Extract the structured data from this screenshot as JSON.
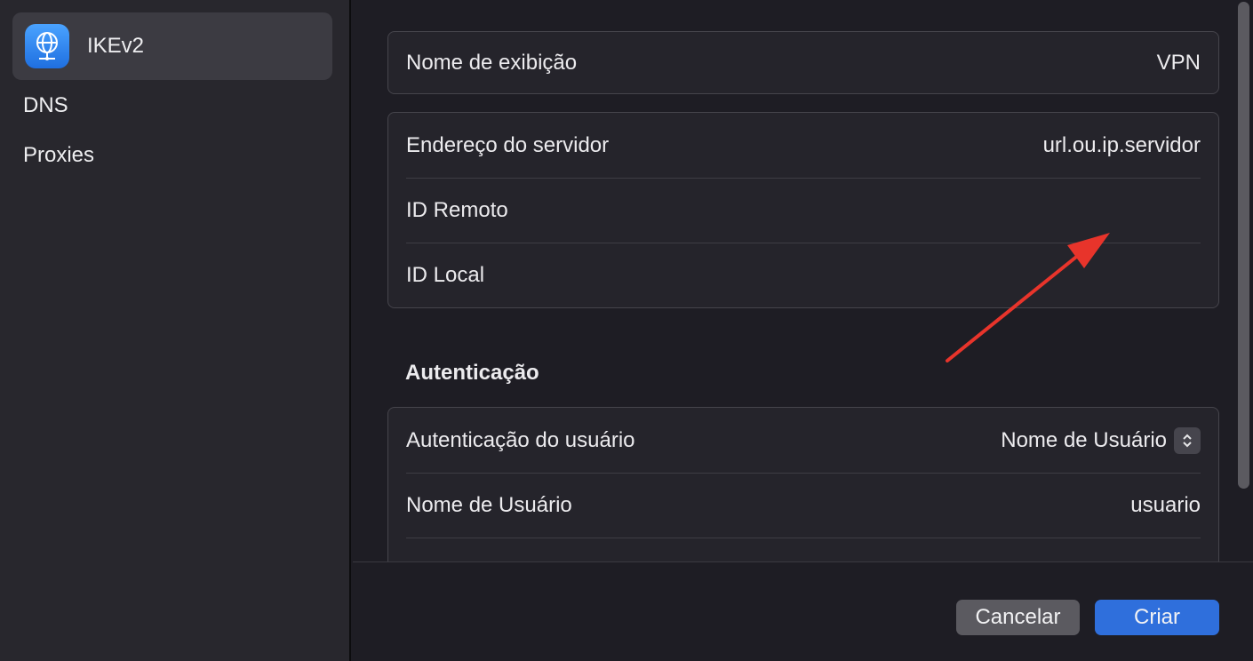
{
  "sidebar": {
    "items": [
      {
        "label": "IKEv2",
        "icon": "globe-network-icon",
        "selected": true
      },
      {
        "label": "DNS"
      },
      {
        "label": "Proxies"
      }
    ]
  },
  "general": {
    "display_name_label": "Nome de exibição",
    "display_name_value": "VPN"
  },
  "server": {
    "address_label": "Endereço do servidor",
    "address_value": "url.ou.ip.servidor",
    "remote_id_label": "ID Remoto",
    "remote_id_value": "",
    "local_id_label": "ID Local",
    "local_id_value": ""
  },
  "auth": {
    "section_title": "Autenticação",
    "user_auth_label": "Autenticação do usuário",
    "user_auth_value": "Nome de Usuário",
    "username_label": "Nome de Usuário",
    "username_value": "usuario"
  },
  "footer": {
    "cancel_label": "Cancelar",
    "create_label": "Criar"
  },
  "colors": {
    "accent": "#2f6fdc",
    "annotation_arrow": "#e8342b"
  }
}
